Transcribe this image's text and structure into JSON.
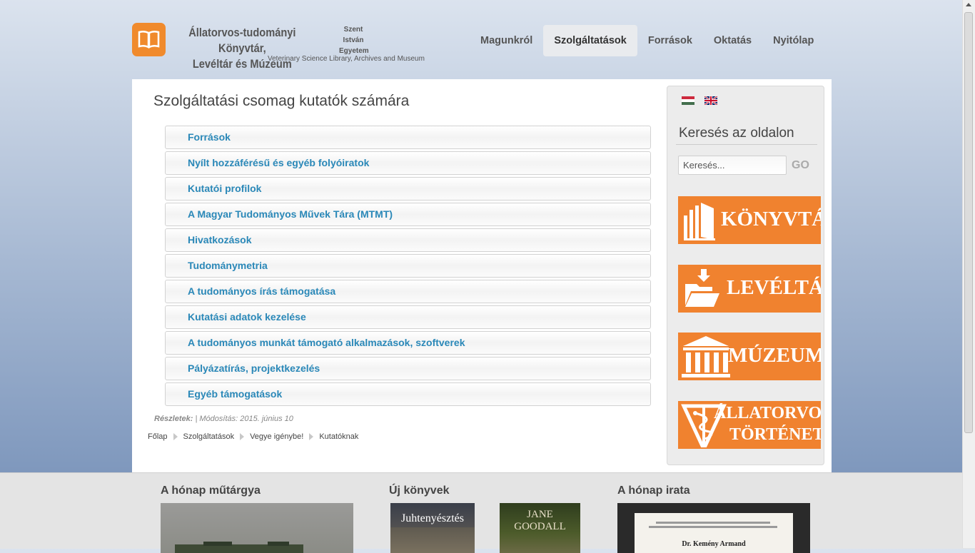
{
  "header": {
    "title_line1": "Állatorvos-tudományi Könyvtár,",
    "title_line2": "Levéltár és Múzeum",
    "university": [
      "Szent",
      "István",
      "Egyetem"
    ],
    "subtitle": "Veterinary Science Library, Archives and Museum"
  },
  "nav": {
    "items": [
      "Magunkról",
      "Szolgáltatások",
      "Források",
      "Oktatás",
      "Nyitólap"
    ],
    "active": "Szolgáltatások"
  },
  "main": {
    "title": "Szolgáltatási csomag kutatók számára",
    "accordion": [
      "Források",
      "Nyílt hozzáférésű és egyéb folyóiratok",
      "Kutatói profilok",
      "A Magyar Tudományos Művek Tára (MTMT)",
      "Hivatkozások",
      "Tudománymetria",
      "A tudományos írás támogatása",
      "Kutatási adatok kezelése",
      "A tudományos munkát támogató alkalmazások, szoftverek",
      "Pályázatírás, projektkezelés",
      "Egyéb támogatások"
    ],
    "meta_label": "Részletek:",
    "meta_text": " | Módosítás: 2015. június 10",
    "breadcrumb": [
      "Főlap",
      "Szolgáltatások",
      "Vegye igénybe!",
      "Kutatóknak"
    ]
  },
  "sidebar": {
    "search_title": "Keresés az oldalon",
    "search_placeholder": "Keresés...",
    "search_go": "GO",
    "banners": [
      "KÖNYVTÁR",
      "LEVÉLTÁR",
      "MÚZEUM",
      "ÁLLATORVOS-",
      "TÖRTÉNET"
    ]
  },
  "bottom": {
    "col1_title": "A hónap műtárgya",
    "col2_title": "Új könyvek",
    "col3_title": "A hónap irata",
    "book1_title": "Juhtenyésztés",
    "book2_title": "JANE GOODALL",
    "document_name": "Dr. Kemény Armand"
  },
  "colors": {
    "accent_orange": "#f0822f",
    "link_blue": "#2a88b8"
  },
  "icons": [
    "open-book-icon",
    "flag-hu-icon",
    "flag-en-icon",
    "books-icon",
    "folder-download-icon",
    "museum-building-icon",
    "caduceus-icon"
  ]
}
